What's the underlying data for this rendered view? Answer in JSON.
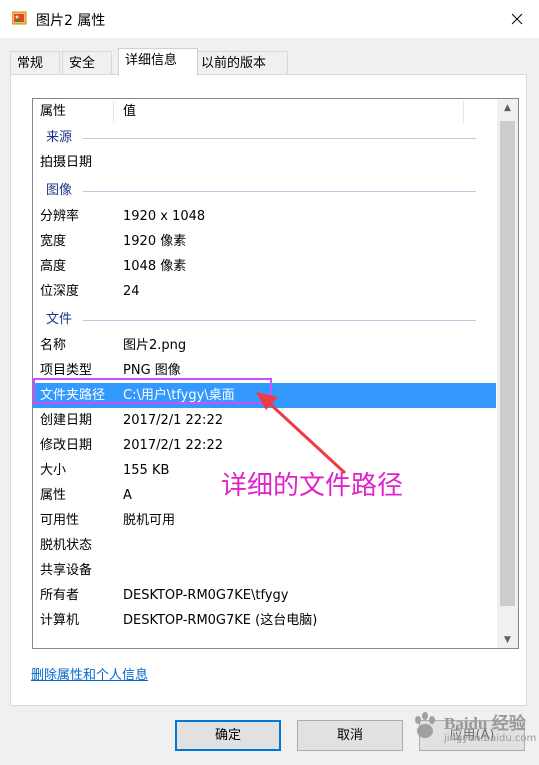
{
  "window": {
    "title": "图片2 属性"
  },
  "tabs": [
    "常规",
    "安全",
    "详细信息",
    "以前的版本"
  ],
  "active_tab": "详细信息",
  "list": {
    "headers": {
      "property": "属性",
      "value": "值"
    },
    "groups": {
      "source": "来源",
      "image": "图像",
      "file": "文件"
    },
    "rows": {
      "date_taken": {
        "label": "拍摄日期",
        "value": ""
      },
      "resolution": {
        "label": "分辨率",
        "value": "1920 x 1048"
      },
      "width": {
        "label": "宽度",
        "value": "1920 像素"
      },
      "height": {
        "label": "高度",
        "value": "1048 像素"
      },
      "bit_depth": {
        "label": "位深度",
        "value": "24"
      },
      "name": {
        "label": "名称",
        "value": "图片2.png"
      },
      "item_type": {
        "label": "项目类型",
        "value": "PNG 图像"
      },
      "folder_path": {
        "label": "文件夹路径",
        "value": "C:\\用户\\tfygy\\桌面"
      },
      "created": {
        "label": "创建日期",
        "value": "2017/2/1 22:22"
      },
      "modified": {
        "label": "修改日期",
        "value": "2017/2/1 22:22"
      },
      "size": {
        "label": "大小",
        "value": "155 KB"
      },
      "attributes": {
        "label": "属性",
        "value": "A"
      },
      "availability": {
        "label": "可用性",
        "value": "脱机可用"
      },
      "offline_status": {
        "label": "脱机状态",
        "value": ""
      },
      "shared_with": {
        "label": "共享设备",
        "value": ""
      },
      "owner": {
        "label": "所有者",
        "value": "DESKTOP-RM0G7KE\\tfygy"
      },
      "computer": {
        "label": "计算机",
        "value": "DESKTOP-RM0G7KE (这台电脑)"
      }
    },
    "selected_row": "folder_path"
  },
  "remove_link": "删除属性和个人信息",
  "buttons": {
    "ok": "确定",
    "cancel": "取消",
    "apply": "应用(A)"
  },
  "annotation": {
    "text": "详细的文件路径",
    "color": "#e023c8"
  },
  "watermark": {
    "name": "Baidu 经验",
    "url": "jingyan.baidu.com"
  },
  "colors": {
    "selection": "#3399ff",
    "link": "#0066cc",
    "group_text": "#1e3287",
    "highlight_border": "#d24dff"
  }
}
